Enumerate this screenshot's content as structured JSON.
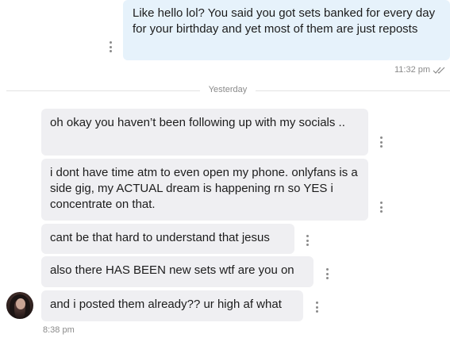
{
  "messages": [
    {
      "id": "m1",
      "direction": "outgoing",
      "text": "Like hello lol? You said you got sets banked for every day for your birthday and yet most of them are just reposts",
      "time": "11:32 pm"
    },
    {
      "id": "m2",
      "direction": "incoming",
      "text": "oh okay you haven’t been following up with my socials .."
    },
    {
      "id": "m3",
      "direction": "incoming",
      "text": "i dont have time atm to even open my phone. onlyfans is a side gig, my ACTUAL dream is happening rn so YES i concentrate on that."
    },
    {
      "id": "m4",
      "direction": "incoming",
      "text": "cant be that hard to understand that jesus"
    },
    {
      "id": "m5",
      "direction": "incoming",
      "text": "also there HAS BEEN new sets wtf are you on"
    },
    {
      "id": "m6",
      "direction": "incoming",
      "text": "and i posted them already?? ur high af what",
      "time": "8:38 pm"
    }
  ],
  "divider": {
    "label": "Yesterday"
  },
  "colors": {
    "outgoing_bubble": "#e6f2fb",
    "incoming_bubble": "#efeff2",
    "read_receipt": "#8a8a8a"
  },
  "icons": {
    "more": "more-vertical-icon",
    "read_receipt": "double-check-icon"
  }
}
